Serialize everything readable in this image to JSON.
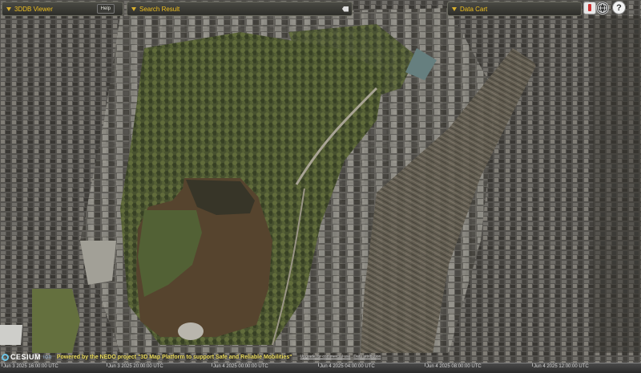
{
  "panels": {
    "viewer": {
      "title": "3DDB Viewer",
      "help_label": "Help"
    },
    "search": {
      "title": "Search Result"
    },
    "cart": {
      "title": "Data Cart"
    }
  },
  "toolbar": {
    "info_icon": "info-icon",
    "globe_icon": "globe-icon",
    "help_glyph": "?"
  },
  "credits": {
    "logo_text": "CESIUM",
    "logo_suffix": "ion",
    "nedo": "Powered by the NEDO project \"3D Map Platform to support Safe and Reliable Mobilities\"",
    "upgrade_link": "Upgrade for commercial use",
    "data_link": "Data attribution"
  },
  "timeline": {
    "labels": [
      "Jun 3 2025 16:00:00 UTC",
      "Jun 3 2025 20:00:00 UTC",
      "Jun 4 2025 00:00:00 UTC",
      "Jun 4 2025 04:00:00 UTC",
      "Jun 4 2025 08:00:00 UTC",
      "Jun 4 2025 12:00:00 UTC"
    ]
  },
  "colors": {
    "panel_text": "#f0c020",
    "pond_green": "#5a6a3a",
    "pond_brown": "#5e4a32",
    "rail": "#6a6456"
  }
}
